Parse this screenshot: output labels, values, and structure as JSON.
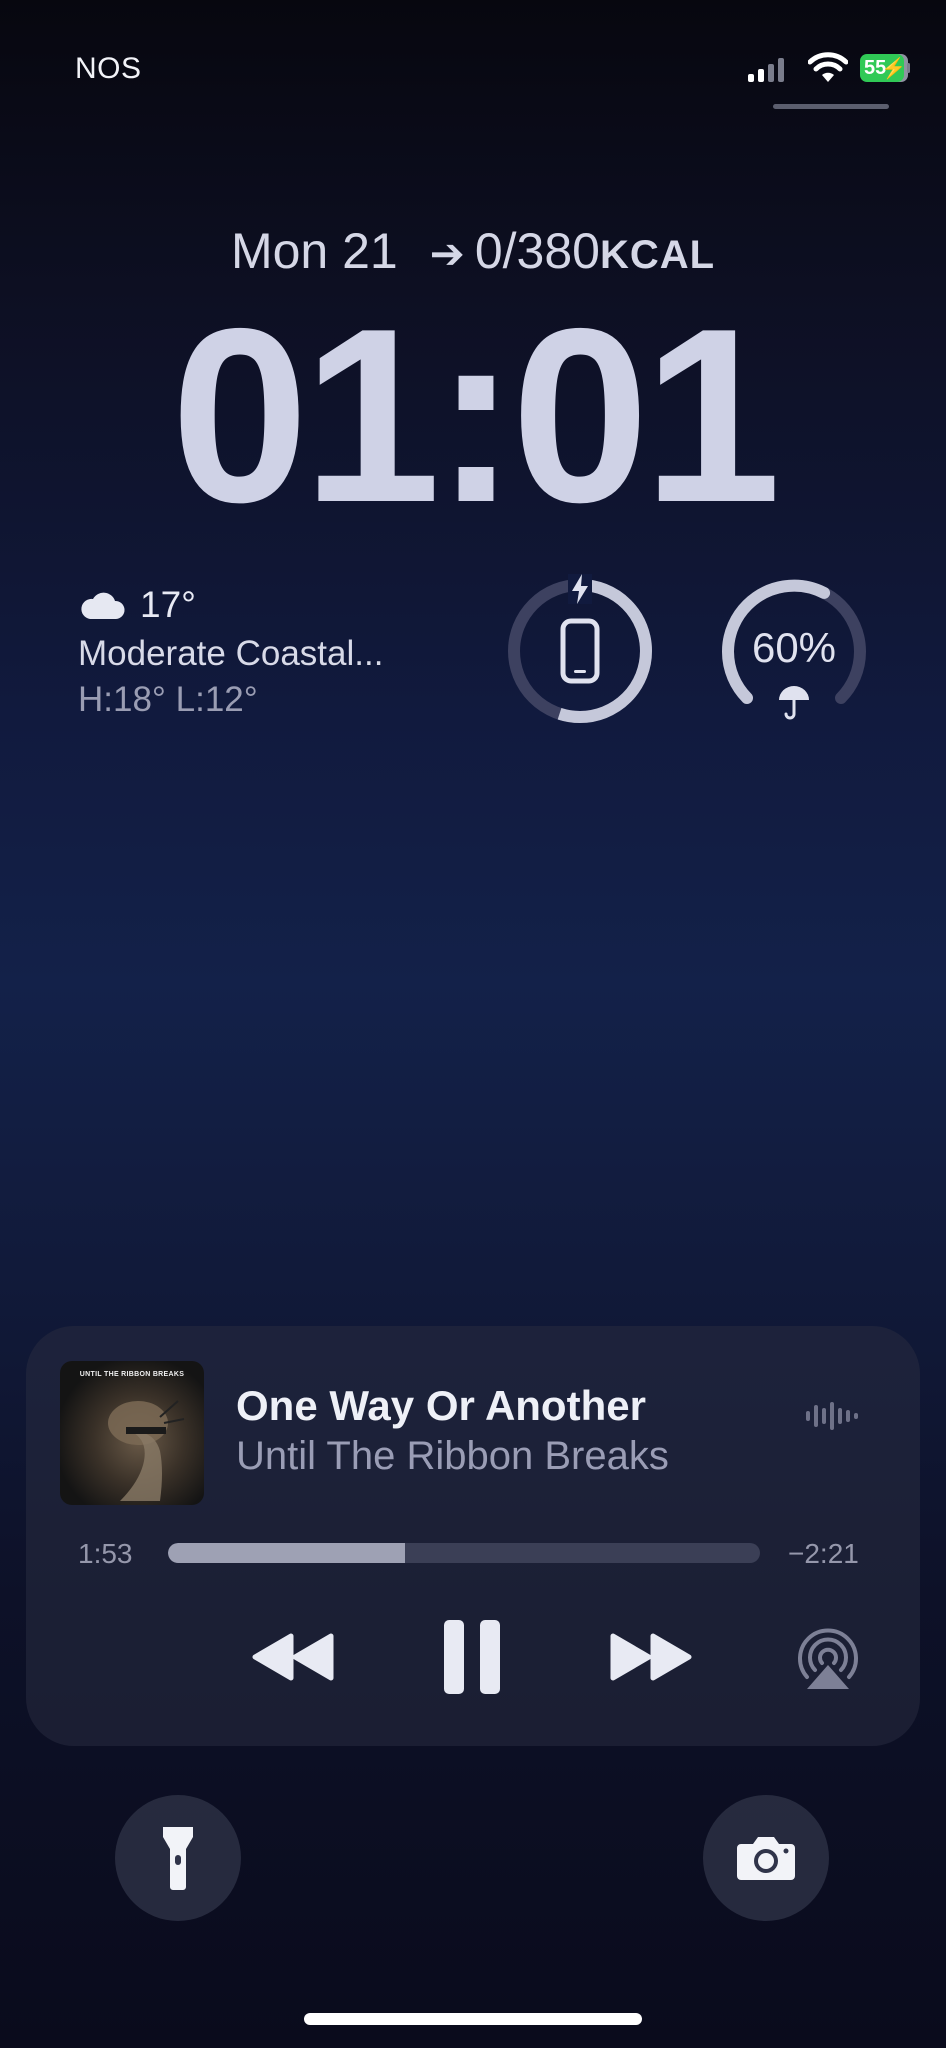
{
  "status_bar": {
    "carrier": "NOS",
    "battery_level": "55",
    "battery_charging": true,
    "cellular_icon": "cellular-signal-icon",
    "wifi_icon": "wifi-icon"
  },
  "lock_screen": {
    "date": "Mon 21",
    "calories": "0/380",
    "calories_unit": "KCAL",
    "time": "01:01"
  },
  "widgets": {
    "weather": {
      "temperature": "17°",
      "condition": "Moderate Coastal...",
      "high_low": "H:18° L:12°",
      "icon": "cloud-icon"
    },
    "battery_ring": {
      "icon": "phone-charging-icon",
      "level_fraction": 0.55
    },
    "rain_ring": {
      "label": "60%",
      "level_fraction": 0.6,
      "icon": "umbrella-icon"
    }
  },
  "now_playing": {
    "title": "One Way Or Another",
    "artist": "Until The Ribbon Breaks",
    "artwork_text": "UNTIL THE RIBBON BREAKS",
    "elapsed": "1:53",
    "remaining": "−2:21",
    "progress_fraction": 0.4
  },
  "colors": {
    "accent_green": "#30c956",
    "text_primary": "#eef0f7",
    "text_secondary": "#9a9db5"
  }
}
